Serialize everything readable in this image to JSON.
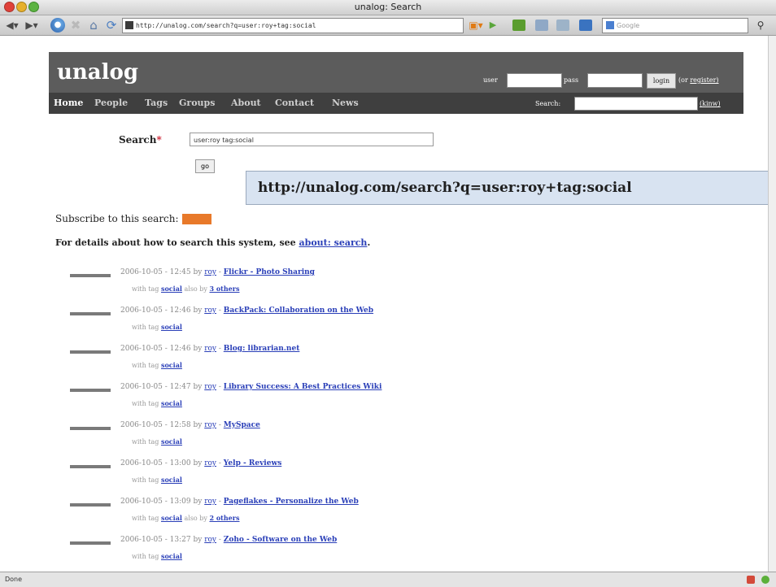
{
  "window": {
    "title": "unalog: Search"
  },
  "browser": {
    "url": "http://unalog.com/search?q=user:roy+tag:social",
    "search_placeholder": "Google",
    "status_text": "Done"
  },
  "site": {
    "logo": "unalog",
    "login": {
      "user_label": "user",
      "pass_label": "pass",
      "login_button": "login",
      "or_text": "(or",
      "register_link": "register)"
    },
    "nav": {
      "items": [
        "Home",
        "People",
        "Tags",
        "Groups",
        "About",
        "Contact",
        "News"
      ],
      "search_label": "Search:",
      "search_extra_link": "(kinw)"
    }
  },
  "search_form": {
    "label": "Search",
    "required_mark": "*",
    "query_value": "user:roy tag:social",
    "go_button": "go"
  },
  "callout": {
    "text": "http://unalog.com/search?q=user:roy+tag:social"
  },
  "subscribe_text": "Subscribe to this search:",
  "details": {
    "prefix": "For details about how to search this system, see ",
    "link": "about: search",
    "suffix": "."
  },
  "results": [
    {
      "date": "2006-10-05 - 12:45",
      "by_label": "by",
      "user": "roy",
      "title": "Flickr - Photo Sharing",
      "with_tag": "with tag",
      "tag": "social",
      "also": "also by",
      "others": "3 others"
    },
    {
      "date": "2006-10-05 - 12:46",
      "by_label": "by",
      "user": "roy",
      "title": "BackPack: Collaboration on the Web",
      "with_tag": "with tag",
      "tag": "social",
      "also": "",
      "others": ""
    },
    {
      "date": "2006-10-05 - 12:46",
      "by_label": "by",
      "user": "roy",
      "title": "Blog: librarian.net",
      "with_tag": "with tag",
      "tag": "social",
      "also": "",
      "others": ""
    },
    {
      "date": "2006-10-05 - 12:47",
      "by_label": "by",
      "user": "roy",
      "title": "Library Success: A Best Practices Wiki",
      "with_tag": "with tag",
      "tag": "social",
      "also": "",
      "others": ""
    },
    {
      "date": "2006-10-05 - 12:58",
      "by_label": "by",
      "user": "roy",
      "title": "MySpace",
      "with_tag": "with tag",
      "tag": "social",
      "also": "",
      "others": ""
    },
    {
      "date": "2006-10-05 - 13:00",
      "by_label": "by",
      "user": "roy",
      "title": "Yelp - Reviews",
      "with_tag": "with tag",
      "tag": "social",
      "also": "",
      "others": ""
    },
    {
      "date": "2006-10-05 - 13:09",
      "by_label": "by",
      "user": "roy",
      "title": "Pageflakes - Personalize the Web",
      "with_tag": "with tag",
      "tag": "social",
      "also": "also by",
      "others": "2 others"
    },
    {
      "date": "2006-10-05 - 13:27",
      "by_label": "by",
      "user": "roy",
      "title": "Zoho - Software on the Web",
      "with_tag": "with tag",
      "tag": "social",
      "also": "",
      "others": ""
    }
  ]
}
